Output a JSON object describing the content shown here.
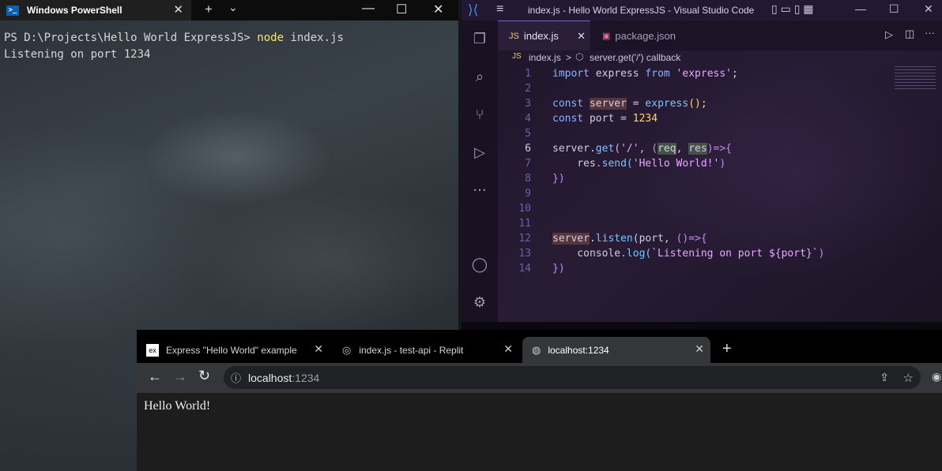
{
  "powershell": {
    "tab_title": "Windows PowerShell",
    "tab_icon": "powershell-icon",
    "new_tab": "+",
    "dropdown": "⌄",
    "prompt": "PS D:\\Projects\\Hello World ExpressJS> ",
    "command": "node",
    "args": " index.js",
    "output": "Listening on port 1234",
    "controls": {
      "minimize": "—",
      "maximize": "☐",
      "close": "✕"
    }
  },
  "vscode": {
    "title": "index.js - Hello World ExpressJS - Visual Studio Code",
    "tabs": [
      {
        "label": "index.js",
        "active": true,
        "icon": "js-file-icon"
      },
      {
        "label": "package.json",
        "active": false,
        "icon": "json-file-icon"
      }
    ],
    "breadcrumb": {
      "file": "index.js",
      "separator": ">",
      "symbol": "server.get('/') callback"
    },
    "activity": [
      "explorer-icon",
      "search-icon",
      "source-control-icon",
      "run-debug-icon",
      "more-icon",
      "account-icon",
      "settings-gear-icon"
    ],
    "line_numbers": [
      "1",
      "2",
      "3",
      "4",
      "5",
      "6",
      "7",
      "8",
      "9",
      "10",
      "11",
      "12",
      "13",
      "14"
    ],
    "code": {
      "l1": {
        "a": "import",
        "b": " express ",
        "c": "from",
        "d": " 'express'",
        "e": ";"
      },
      "l3": {
        "a": "const ",
        "b": "server",
        "c": " = ",
        "d": "express",
        "e": "();"
      },
      "l4": {
        "a": "const ",
        "b": "port = ",
        "c": "1234"
      },
      "l6": {
        "a": "server",
        "b": ".",
        "c": "get",
        "d": "('/', ",
        "e": "(",
        "f": "req",
        ",": ", ",
        "g": "res",
        "h": ")=>{"
      },
      "l7": {
        "a": "    res",
        "b": ".send(",
        "c": "'Hello World!'",
        "d": ")"
      },
      "l8": "})",
      "l12": {
        "a": "server",
        "b": ".",
        "c": "listen",
        "d": "(port, ",
        "e": "()=>{"
      },
      "l13": {
        "a": "    console",
        "b": ".log(",
        "c": "`Listening on port ${port}`",
        "d": ")"
      },
      "l14": "})"
    }
  },
  "browser": {
    "tabs": [
      {
        "label": "Express \"Hello World\" example",
        "icon": "express-favicon-icon",
        "favicon_text": "ex"
      },
      {
        "label": "index.js - test-api - Replit",
        "icon": "replit-favicon-icon"
      },
      {
        "label": "localhost:1234",
        "icon": "globe-favicon-icon"
      }
    ],
    "new_tab": "+",
    "url_host": "localhost",
    "url_port": ":1234",
    "page_text": "Hello World!"
  }
}
